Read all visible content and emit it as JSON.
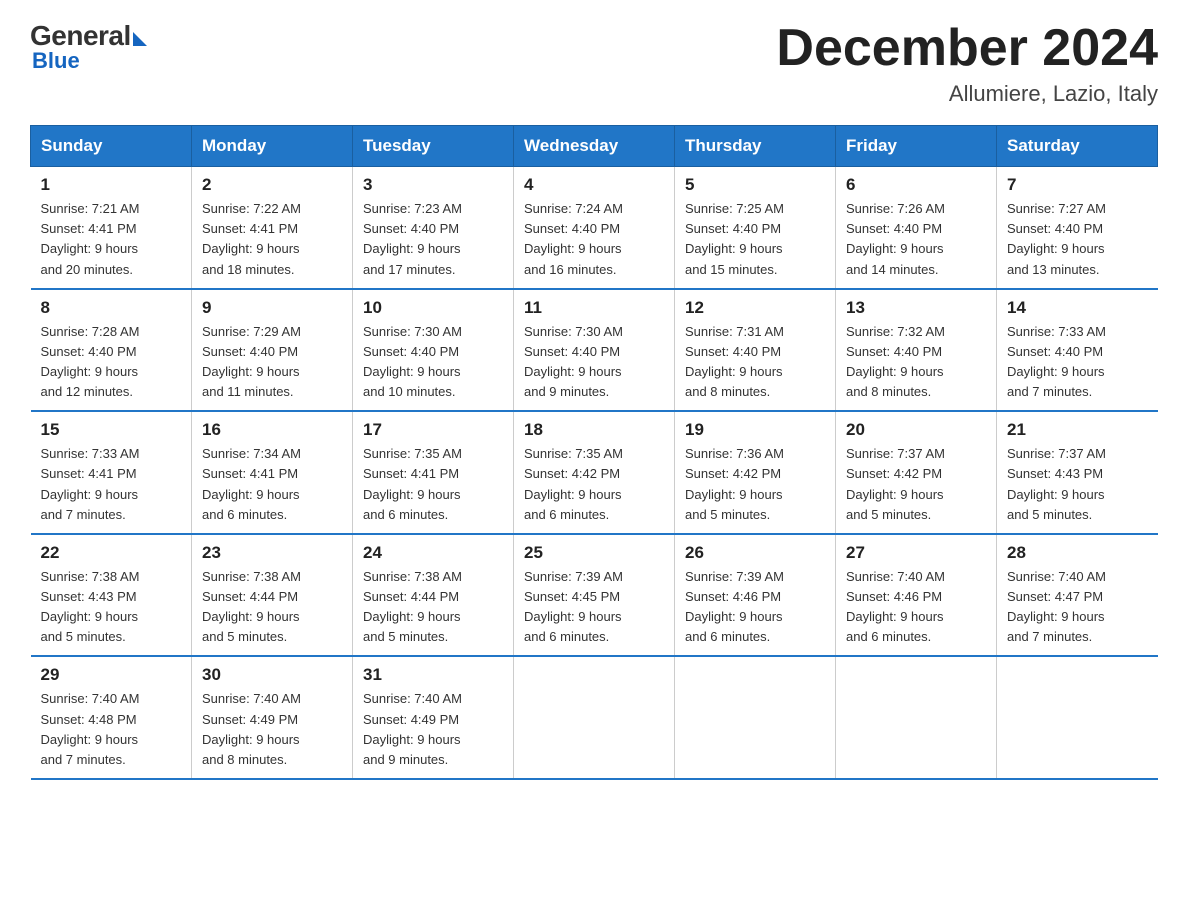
{
  "logo": {
    "general": "General",
    "blue": "Blue"
  },
  "title": "December 2024",
  "location": "Allumiere, Lazio, Italy",
  "days_of_week": [
    "Sunday",
    "Monday",
    "Tuesday",
    "Wednesday",
    "Thursday",
    "Friday",
    "Saturday"
  ],
  "weeks": [
    [
      {
        "day": "1",
        "sunrise": "7:21 AM",
        "sunset": "4:41 PM",
        "daylight": "9 hours and 20 minutes."
      },
      {
        "day": "2",
        "sunrise": "7:22 AM",
        "sunset": "4:41 PM",
        "daylight": "9 hours and 18 minutes."
      },
      {
        "day": "3",
        "sunrise": "7:23 AM",
        "sunset": "4:40 PM",
        "daylight": "9 hours and 17 minutes."
      },
      {
        "day": "4",
        "sunrise": "7:24 AM",
        "sunset": "4:40 PM",
        "daylight": "9 hours and 16 minutes."
      },
      {
        "day": "5",
        "sunrise": "7:25 AM",
        "sunset": "4:40 PM",
        "daylight": "9 hours and 15 minutes."
      },
      {
        "day": "6",
        "sunrise": "7:26 AM",
        "sunset": "4:40 PM",
        "daylight": "9 hours and 14 minutes."
      },
      {
        "day": "7",
        "sunrise": "7:27 AM",
        "sunset": "4:40 PM",
        "daylight": "9 hours and 13 minutes."
      }
    ],
    [
      {
        "day": "8",
        "sunrise": "7:28 AM",
        "sunset": "4:40 PM",
        "daylight": "9 hours and 12 minutes."
      },
      {
        "day": "9",
        "sunrise": "7:29 AM",
        "sunset": "4:40 PM",
        "daylight": "9 hours and 11 minutes."
      },
      {
        "day": "10",
        "sunrise": "7:30 AM",
        "sunset": "4:40 PM",
        "daylight": "9 hours and 10 minutes."
      },
      {
        "day": "11",
        "sunrise": "7:30 AM",
        "sunset": "4:40 PM",
        "daylight": "9 hours and 9 minutes."
      },
      {
        "day": "12",
        "sunrise": "7:31 AM",
        "sunset": "4:40 PM",
        "daylight": "9 hours and 8 minutes."
      },
      {
        "day": "13",
        "sunrise": "7:32 AM",
        "sunset": "4:40 PM",
        "daylight": "9 hours and 8 minutes."
      },
      {
        "day": "14",
        "sunrise": "7:33 AM",
        "sunset": "4:40 PM",
        "daylight": "9 hours and 7 minutes."
      }
    ],
    [
      {
        "day": "15",
        "sunrise": "7:33 AM",
        "sunset": "4:41 PM",
        "daylight": "9 hours and 7 minutes."
      },
      {
        "day": "16",
        "sunrise": "7:34 AM",
        "sunset": "4:41 PM",
        "daylight": "9 hours and 6 minutes."
      },
      {
        "day": "17",
        "sunrise": "7:35 AM",
        "sunset": "4:41 PM",
        "daylight": "9 hours and 6 minutes."
      },
      {
        "day": "18",
        "sunrise": "7:35 AM",
        "sunset": "4:42 PM",
        "daylight": "9 hours and 6 minutes."
      },
      {
        "day": "19",
        "sunrise": "7:36 AM",
        "sunset": "4:42 PM",
        "daylight": "9 hours and 5 minutes."
      },
      {
        "day": "20",
        "sunrise": "7:37 AM",
        "sunset": "4:42 PM",
        "daylight": "9 hours and 5 minutes."
      },
      {
        "day": "21",
        "sunrise": "7:37 AM",
        "sunset": "4:43 PM",
        "daylight": "9 hours and 5 minutes."
      }
    ],
    [
      {
        "day": "22",
        "sunrise": "7:38 AM",
        "sunset": "4:43 PM",
        "daylight": "9 hours and 5 minutes."
      },
      {
        "day": "23",
        "sunrise": "7:38 AM",
        "sunset": "4:44 PM",
        "daylight": "9 hours and 5 minutes."
      },
      {
        "day": "24",
        "sunrise": "7:38 AM",
        "sunset": "4:44 PM",
        "daylight": "9 hours and 5 minutes."
      },
      {
        "day": "25",
        "sunrise": "7:39 AM",
        "sunset": "4:45 PM",
        "daylight": "9 hours and 6 minutes."
      },
      {
        "day": "26",
        "sunrise": "7:39 AM",
        "sunset": "4:46 PM",
        "daylight": "9 hours and 6 minutes."
      },
      {
        "day": "27",
        "sunrise": "7:40 AM",
        "sunset": "4:46 PM",
        "daylight": "9 hours and 6 minutes."
      },
      {
        "day": "28",
        "sunrise": "7:40 AM",
        "sunset": "4:47 PM",
        "daylight": "9 hours and 7 minutes."
      }
    ],
    [
      {
        "day": "29",
        "sunrise": "7:40 AM",
        "sunset": "4:48 PM",
        "daylight": "9 hours and 7 minutes."
      },
      {
        "day": "30",
        "sunrise": "7:40 AM",
        "sunset": "4:49 PM",
        "daylight": "9 hours and 8 minutes."
      },
      {
        "day": "31",
        "sunrise": "7:40 AM",
        "sunset": "4:49 PM",
        "daylight": "9 hours and 9 minutes."
      },
      null,
      null,
      null,
      null
    ]
  ]
}
